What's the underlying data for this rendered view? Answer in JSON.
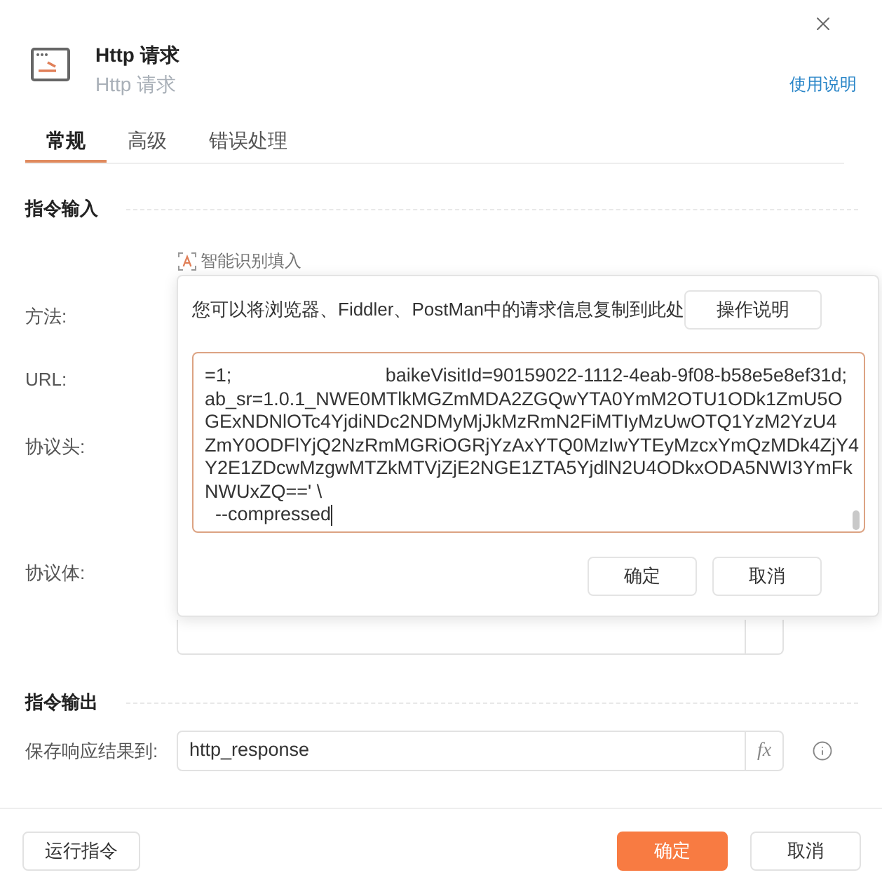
{
  "dialog": {
    "title": "Http 请求",
    "subtitle": "Http 请求",
    "help_link": "使用说明"
  },
  "tabs": [
    {
      "label": "常规",
      "selected": true
    },
    {
      "label": "高级",
      "selected": false
    },
    {
      "label": "错误处理",
      "selected": false
    }
  ],
  "input_section": {
    "title": "指令输入",
    "smart_fill": "智能识别填入",
    "fields": [
      {
        "label": "方法:"
      },
      {
        "label": "URL:"
      },
      {
        "label": "协议头:"
      },
      {
        "label": "协议体:"
      }
    ]
  },
  "smart_fill_popover": {
    "hint": "您可以将浏览器、Fiddler、PostMan中的请求信息复制到此处",
    "guide_button": "操作说明",
    "text_lines": [
      [
        "=1;",
        "baikeVisitId=90159022-1112-4eab-9f08-b58e5e8ef31d;"
      ],
      [
        "ab_sr=1.0.1_NWE0MTlkMGZmMDA2ZGQwYTA0YmM2OTU1ODk1ZmU5O"
      ],
      [
        "GExNDNlOTc4YjdiNDc2NDMyMjJkMzRmN2FiMTIyMzUwOTQ1YzM2YzU4"
      ],
      [
        "ZmY0ODFlYjQ2NzRmMGRiOGRjYzAxYTQ0MzIwYTEyMzcxYmQzMDk4ZjY4"
      ],
      [
        "Y2E1ZDcwMzgwMTZkMTVjZjE2NGE1ZTA5YjdlN2U4ODkxODA5NWI3YmFk"
      ],
      [
        "NWUxZQ==' \\"
      ],
      [
        "  --compressed"
      ]
    ],
    "buttons": [
      "确定",
      "取消"
    ]
  },
  "output_section": {
    "title": "指令输出",
    "fields": [
      {
        "label": "保存响应结果到:",
        "value": "http_response",
        "fx": "fx"
      }
    ]
  },
  "footer": {
    "run_button": "运行指令",
    "buttons": [
      {
        "label": "确定",
        "kind": "primary"
      },
      {
        "label": "取消",
        "kind": "secondary"
      }
    ]
  }
}
